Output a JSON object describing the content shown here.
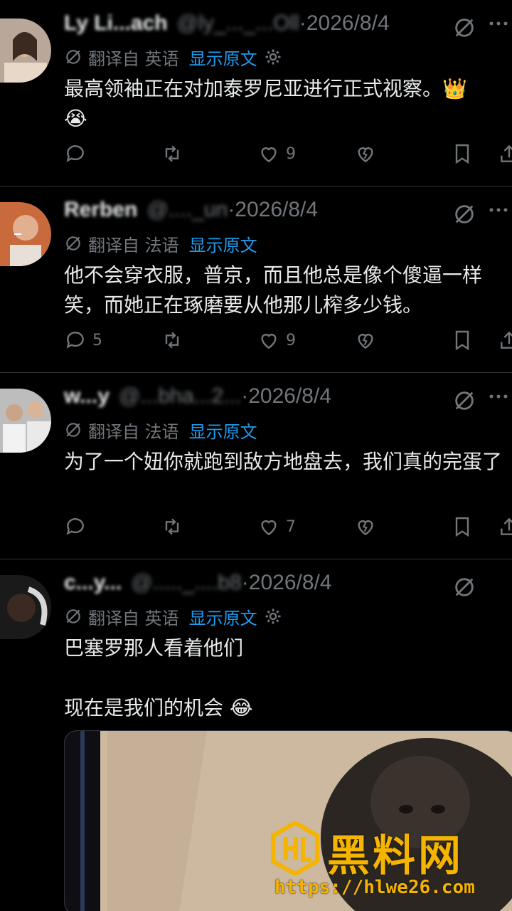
{
  "tweets": [
    {
      "name": "Ly Li...ach",
      "handle_blur": "@ly_..._...Oll",
      "date": "·2026/8/4",
      "translated_from": "翻译自 英语",
      "show_original": "显示原文",
      "text": "最高领袖正在对加泰罗尼亚进行正式视察。👑\n😭",
      "replies": "",
      "retweets": "",
      "likes": "9",
      "has_settings": true,
      "avatar_color": "#b9a79a"
    },
    {
      "name": "Rerben",
      "handle_blur": "@...._un",
      "date": "·2026/8/4",
      "translated_from": "翻译自 法语",
      "show_original": "显示原文",
      "text": "他不会穿衣服，普京，而且他总是像个傻逼一样笑，而她正在琢磨要从他那儿榨多少钱。",
      "replies": "5",
      "retweets": "",
      "likes": "9",
      "has_settings": false,
      "avatar_color": "#c96a3c"
    },
    {
      "name": "w...y",
      "handle_blur": "@...bha...2...",
      "date": "·2026/8/4",
      "translated_from": "翻译自 法语",
      "show_original": "显示原文",
      "text": "为了一个妞你就跑到敌方地盘去，我们真的完蛋了",
      "replies": "",
      "retweets": "",
      "likes": "7",
      "has_settings": false,
      "avatar_color": "#d0d0d0"
    },
    {
      "name": "c...y...",
      "handle_blur": "@....._....b8",
      "date": "·2026/8/4",
      "translated_from": "翻译自 英语",
      "show_original": "显示原文",
      "text": "巴塞罗那人看着他们\n\n现在是我们的机会 😂",
      "replies": "",
      "retweets": "",
      "likes": "",
      "has_settings": true,
      "avatar_color": "#3a3a3a"
    }
  ],
  "watermark": {
    "title": "黑料网",
    "url": "https://hlwe26.com"
  },
  "colors": {
    "background": "#000000",
    "text": "#e7e9ea",
    "muted": "#71767b",
    "link": "#1d9bf0",
    "watermark": "#f5b400"
  }
}
